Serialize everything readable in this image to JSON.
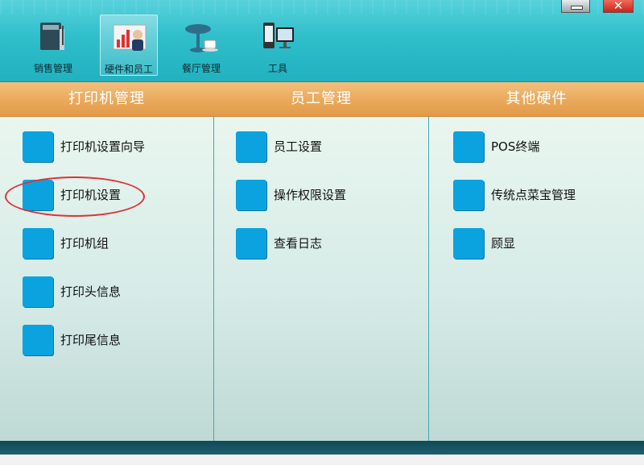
{
  "toolbar": {
    "tools": [
      {
        "label": "销售管理",
        "icon": "book-ledger-icon"
      },
      {
        "label": "硬件和员工",
        "icon": "staff-chart-icon",
        "active": true
      },
      {
        "label": "餐厅管理",
        "icon": "table-cup-icon"
      },
      {
        "label": "工具",
        "icon": "device-monitor-icon"
      }
    ],
    "close_glyph": "✕"
  },
  "columns": [
    {
      "header": "打印机管理",
      "items": [
        "打印机设置向导",
        "打印机设置",
        "打印机组",
        "打印头信息",
        "打印尾信息"
      ]
    },
    {
      "header": "员工管理",
      "items": [
        "员工设置",
        "操作权限设置",
        "查看日志"
      ]
    },
    {
      "header": "其他硬件",
      "items": [
        "POS终端",
        "传统点菜宝管理",
        "顾显"
      ]
    }
  ],
  "colors": {
    "toolbar": "#2fbfcb",
    "header_band": "#e9a95a",
    "item_square": "#0aa3df",
    "highlight": "#e0303a"
  }
}
